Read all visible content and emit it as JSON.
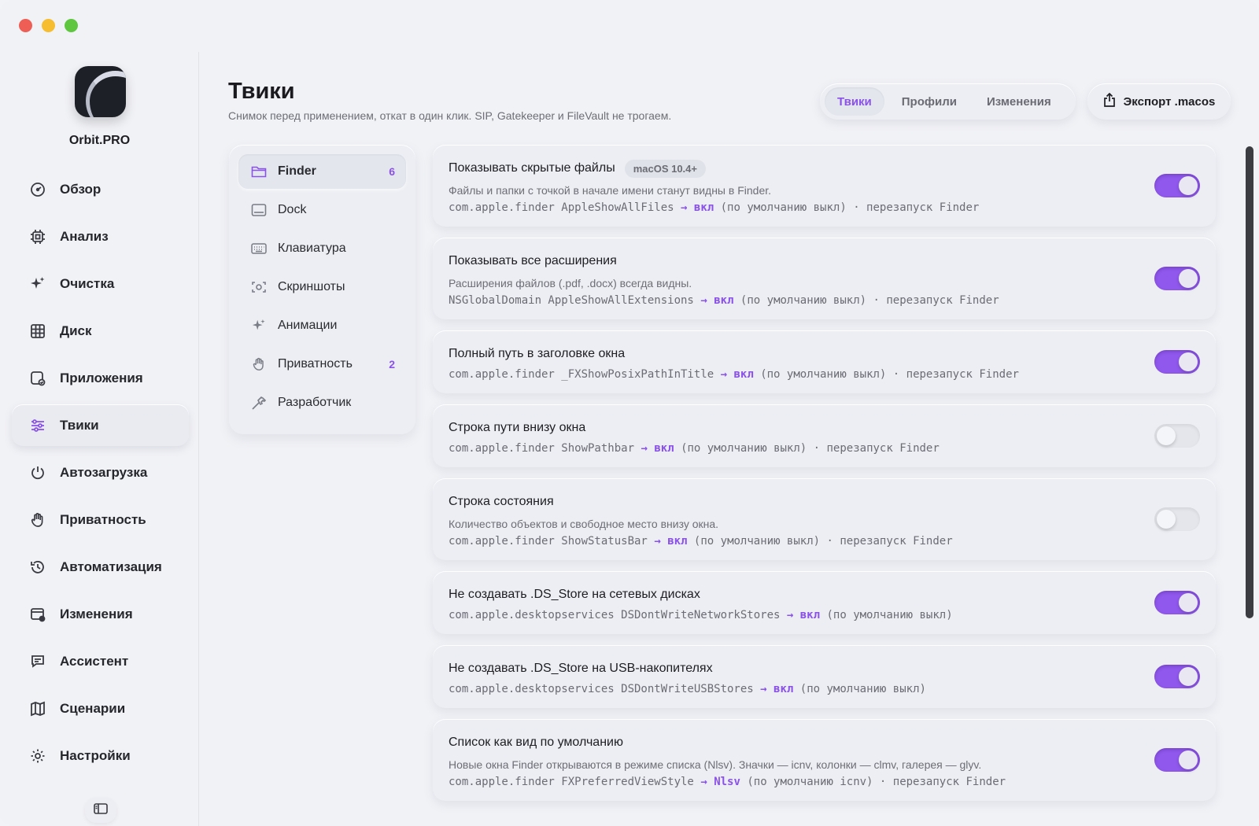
{
  "app": {
    "name": "Orbit.PRO"
  },
  "sidebar": {
    "items": [
      {
        "label": "Обзор",
        "icon": "dashboard-icon"
      },
      {
        "label": "Анализ",
        "icon": "chip-icon"
      },
      {
        "label": "Очистка",
        "icon": "sparkle-icon"
      },
      {
        "label": "Диск",
        "icon": "grid-icon"
      },
      {
        "label": "Приложения",
        "icon": "apps-icon"
      },
      {
        "label": "Твики",
        "icon": "sliders-icon",
        "active": true
      },
      {
        "label": "Автозагрузка",
        "icon": "power-icon"
      },
      {
        "label": "Приватность",
        "icon": "hand-icon"
      },
      {
        "label": "Автоматизация",
        "icon": "history-icon"
      },
      {
        "label": "Изменения",
        "icon": "calendar-icon"
      },
      {
        "label": "Ассистент",
        "icon": "chat-icon"
      },
      {
        "label": "Сценарии",
        "icon": "map-icon"
      },
      {
        "label": "Настройки",
        "icon": "gear-icon"
      }
    ]
  },
  "header": {
    "title": "Твики",
    "subtitle": "Снимок перед применением, откат в один клик. SIP, Gatekeeper и FileVault не трогаем.",
    "tabs": [
      "Твики",
      "Профили",
      "Изменения"
    ],
    "active_tab": "Твики",
    "export_label": "Экспорт .macos"
  },
  "categories": [
    {
      "label": "Finder",
      "count": "6",
      "icon": "folder-icon",
      "active": true
    },
    {
      "label": "Dock",
      "count": "",
      "icon": "dock-icon"
    },
    {
      "label": "Клавиатура",
      "count": "",
      "icon": "keyboard-icon"
    },
    {
      "label": "Скриншоты",
      "count": "",
      "icon": "screenshot-icon"
    },
    {
      "label": "Анимации",
      "count": "",
      "icon": "sparkle-icon"
    },
    {
      "label": "Приватность",
      "count": "2",
      "icon": "hand-icon"
    },
    {
      "label": "Разработчик",
      "count": "",
      "icon": "hammer-icon"
    }
  ],
  "tweaks": [
    {
      "title": "Показывать скрытые файлы",
      "badge": "macOS 10.4+",
      "desc": "Файлы и папки с точкой в начале имени станут видны в Finder.",
      "code": "com.apple.finder AppleShowAllFiles",
      "arrow": "→",
      "value": "вкл",
      "rest": "(по умолчанию выкл) · перезапуск Finder",
      "enabled": true
    },
    {
      "title": "Показывать все расширения",
      "badge": "",
      "desc": "Расширения файлов (.pdf, .docx) всегда видны.",
      "code": "NSGlobalDomain AppleShowAllExtensions",
      "arrow": "→",
      "value": "вкл",
      "rest": "(по умолчанию выкл) · перезапуск Finder",
      "enabled": true
    },
    {
      "title": "Полный путь в заголовке окна",
      "badge": "",
      "desc": "",
      "code": "com.apple.finder _FXShowPosixPathInTitle",
      "arrow": "→",
      "value": "вкл",
      "rest": "(по умолчанию выкл) · перезапуск Finder",
      "enabled": true
    },
    {
      "title": "Строка пути внизу окна",
      "badge": "",
      "desc": "",
      "code": "com.apple.finder ShowPathbar",
      "arrow": "→",
      "value": "вкл",
      "rest": "(по умолчанию выкл) · перезапуск Finder",
      "enabled": false
    },
    {
      "title": "Строка состояния",
      "badge": "",
      "desc": "Количество объектов и свободное место внизу окна.",
      "code": "com.apple.finder ShowStatusBar",
      "arrow": "→",
      "value": "вкл",
      "rest": "(по умолчанию выкл) · перезапуск Finder",
      "enabled": false
    },
    {
      "title": "Не создавать .DS_Store на сетевых дисках",
      "badge": "",
      "desc": "",
      "code": "com.apple.desktopservices DSDontWriteNetworkStores",
      "arrow": "→",
      "value": "вкл",
      "rest": "(по умолчанию выкл)",
      "enabled": true
    },
    {
      "title": "Не создавать .DS_Store на USB-накопителях",
      "badge": "",
      "desc": "",
      "code": "com.apple.desktopservices DSDontWriteUSBStores",
      "arrow": "→",
      "value": "вкл",
      "rest": "(по умолчанию выкл)",
      "enabled": true
    },
    {
      "title": "Список как вид по умолчанию",
      "badge": "",
      "desc": "Новые окна Finder открываются в режиме списка (Nlsv). Значки — icnv, колонки — clmv, галерея — glyv.",
      "code": "com.apple.finder FXPreferredViewStyle",
      "arrow": "→",
      "value": "Nlsv",
      "rest": "(по умолчанию icnv) · перезапуск Finder",
      "enabled": true
    }
  ],
  "colors": {
    "accent": "#8a52e8",
    "background": "#f1f2f6"
  }
}
